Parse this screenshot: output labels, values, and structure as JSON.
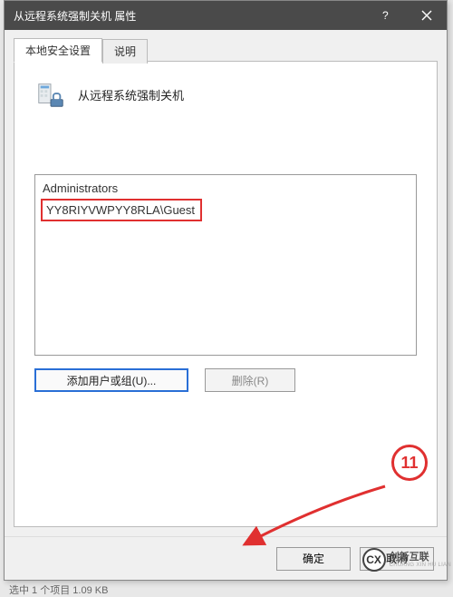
{
  "window": {
    "title": "从远程系统强制关机 属性"
  },
  "tabs": {
    "active": "本地安全设置",
    "inactive": "说明"
  },
  "policy": {
    "name": "从远程系统强制关机"
  },
  "members": [
    "Administrators",
    "YY8RIYVWPYY8RLA\\Guest"
  ],
  "buttons": {
    "add": "添加用户或组(U)...",
    "remove": "删除(R)",
    "ok": "确定",
    "cancel": "取消"
  },
  "annotation": {
    "step": "11"
  },
  "background": {
    "bottom_text": "选中 1 个项目  1.09 KB"
  },
  "watermark": {
    "cn": "创新互联",
    "en": "CHUANG XIN HU LIAN"
  }
}
